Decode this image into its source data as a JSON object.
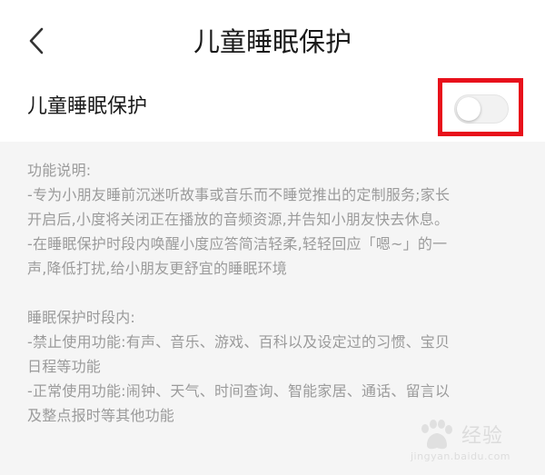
{
  "header": {
    "title": "儿童睡眠保护"
  },
  "setting": {
    "label": "儿童睡眠保护",
    "toggle_on": false,
    "toggle_color": "#f2f2f2",
    "highlight_color": "#e8101b"
  },
  "description": {
    "lines": [
      "功能说明:",
      "-专为小朋友睡前沉迷听故事或音乐而不睡觉推出的定制服务;家长",
      "开启后,小度将关闭正在播放的音频资源,并告知小朋友快去休息。",
      "-在睡眠保护时段内唤醒小度应答简洁轻柔,轻轻回应「嗯~」的一",
      "声,降低打扰,给小朋友更舒宜的睡眠环境",
      "",
      "睡眠保护时段内:",
      "-禁止使用功能:有声、音乐、游戏、百科以及设定过的习惯、宝贝",
      "日程等功能",
      "-正常使用功能:闹钟、天气、时间查询、智能家居、通话、留言以",
      "及整点报时等其他功能"
    ]
  },
  "watermark": {
    "text": "经验",
    "url": "jingyan.baidu.com",
    "icon": "baidu-paw-icon"
  },
  "icons": {
    "back": "chevron-left-icon"
  }
}
